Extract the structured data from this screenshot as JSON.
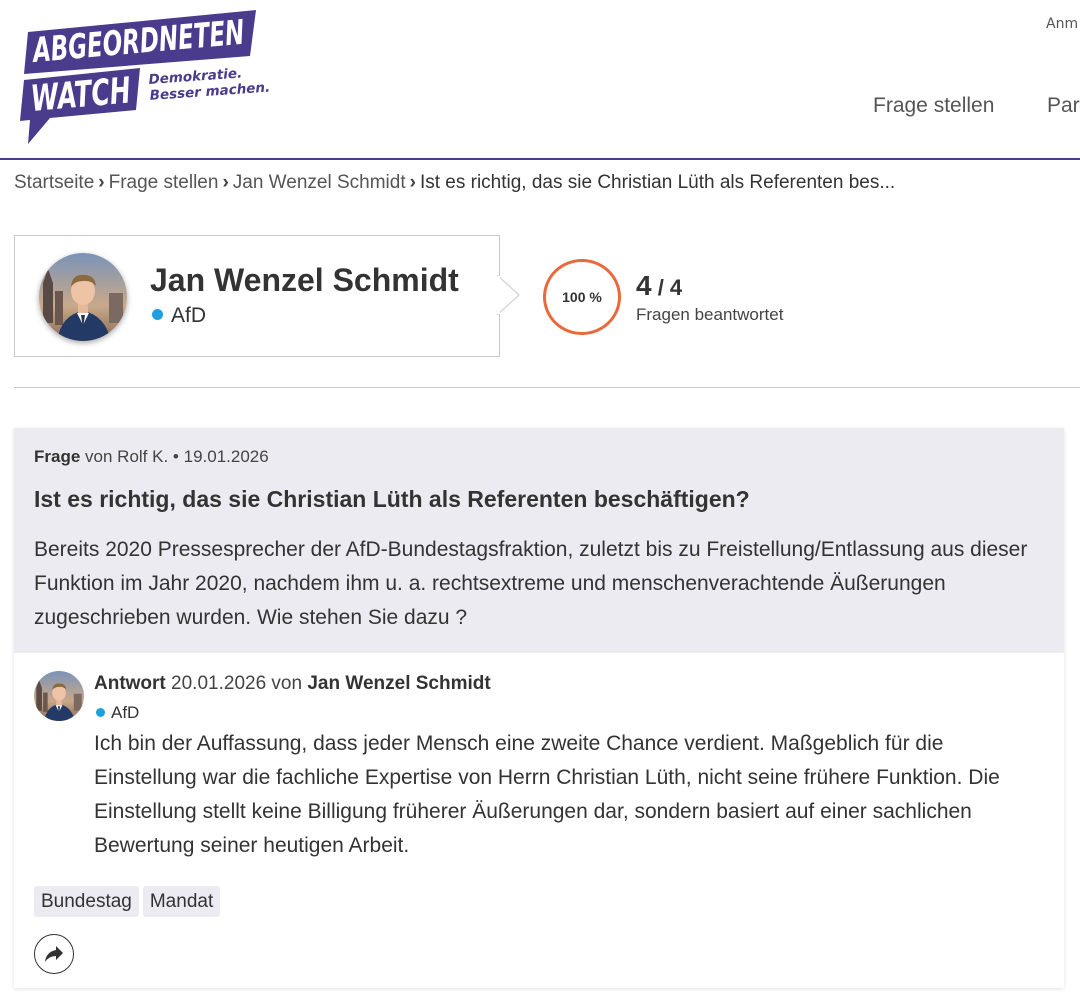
{
  "header": {
    "logo": {
      "line1": "ABGEORDNETEN",
      "line2": "WATCH",
      "tagline_1": "Demokratie.",
      "tagline_2": "Besser machen."
    },
    "top_link": "Anm",
    "nav": [
      "Frage stellen",
      "Par"
    ]
  },
  "breadcrumb": {
    "items": [
      "Startseite",
      "Frage stellen",
      "Jan Wenzel Schmidt"
    ],
    "current": "Ist es richtig, das sie Christian Lüth als Referenten bes..."
  },
  "politician": {
    "name": "Jan Wenzel Schmidt",
    "party": "AfD",
    "party_color": "#1ea0e0"
  },
  "stats": {
    "percent_label": "100 %",
    "answered": "4",
    "total": "4",
    "label": "Fragen beantwortet",
    "ring_color": "#e8693a"
  },
  "question": {
    "label": "Frage",
    "from": "von Rolf K.",
    "date": "19.01.2026",
    "title": "Ist es richtig, das sie Christian Lüth als Referenten beschäftigen?",
    "body": "Bereits 2020 Pressesprecher der AfD-Bundestagsfraktion, zuletzt bis zu Freistellung/Entlassung aus dieser Funktion im Jahr 2020, nachdem ihm u. a. rechtsextreme und menschenverachtende Äußerungen zugeschrieben wurden. Wie stehen Sie dazu ?"
  },
  "answer": {
    "label": "Antwort",
    "date": "20.01.2026",
    "by_word": "von",
    "author": "Jan Wenzel Schmidt",
    "party": "AfD",
    "body": "Ich bin der Auffassung, dass jeder Mensch eine zweite Chance verdient. Maßgeblich für die Einstellung war die fachliche Expertise von Herrn Christian Lüth, nicht seine frühere Funktion. Die Einstellung stellt keine Billigung früherer Äußerungen dar, sondern basiert auf einer sachlichen Bewertung seiner heutigen Arbeit.",
    "tags": [
      "Bundestag",
      "Mandat"
    ]
  },
  "colors": {
    "brand_purple": "#4a3b8c",
    "question_bg": "#ecebf1"
  }
}
